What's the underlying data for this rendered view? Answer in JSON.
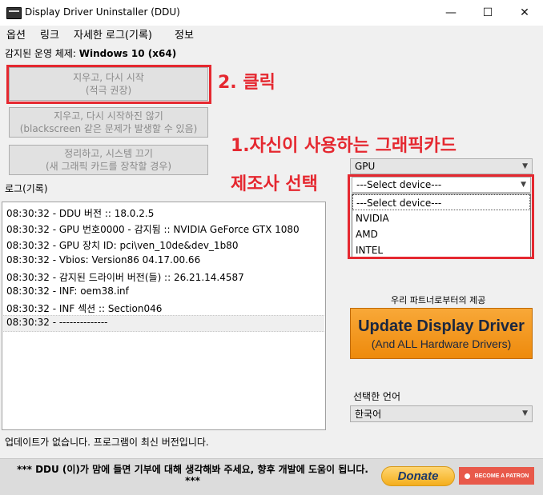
{
  "window": {
    "title": "Display Driver Uninstaller (DDU)",
    "minimize": "—",
    "maximize": "☐",
    "close": "✕"
  },
  "menu": [
    "옵션",
    "링크",
    "자세한 로그(기록)",
    "정보"
  ],
  "os": {
    "label": "감지된 운영 체제:",
    "value": "Windows 10 (x64)"
  },
  "buttons": {
    "clean_restart": {
      "line1": "지우고, 다시 시작",
      "line2": "(적극 권장)"
    },
    "clean_no_restart": {
      "line1": "지우고, 다시 시작하진 않기",
      "line2": "(blackscreen 같은 문제가 발생할 수 있음)"
    },
    "clean_shutdown": {
      "line1": "정리하고, 시스템 끄기",
      "line2": "(새 그래픽 카드를 장착할 경우)"
    }
  },
  "annotations": {
    "step2": "2. 클릭",
    "step1_line1": "1.자신이 사용하는 그래픽카드",
    "step1_line2": "제조사 선택"
  },
  "log": {
    "label": "로그(기록)",
    "lines": [
      "08:30:32 - DDU 버전 :: 18.0.2.5",
      "08:30:32 - GPU 번호0000 - 감지됨 :: NVIDIA GeForce GTX 1080",
      "08:30:32 - GPU 장치 ID: pci\\ven_10de&dev_1b80",
      "08:30:32 - Vbios: Version86 04.17.00.66",
      "08:30:32 - 감지된 드라이버 버전(들) :: 26.21.14.4587",
      "08:30:32 - INF: oem38.inf",
      "08:30:32 - INF 섹션 :: Section046",
      "08:30:32 - --------------"
    ]
  },
  "device_type": {
    "selected": "GPU"
  },
  "device_select": {
    "selected": "---Select device---",
    "options": [
      "---Select device---",
      "NVIDIA",
      "AMD",
      "INTEL"
    ]
  },
  "partner": {
    "label": "우리 파트너로부터의 제공",
    "banner_main": "Update Display Driver",
    "banner_sub": "(And ALL Hardware Drivers)"
  },
  "language": {
    "label": "선택한 언어",
    "selected": "한국어"
  },
  "status": "업데이트가 없습니다.  프로그램이 최신 버전입니다.",
  "footer": {
    "message_line1": "*** DDU (이)가 맘에 들면 기부에 대해 생각해봐 주세요, 향후 개발에 도움이 됩니다.",
    "message_line2": "***",
    "donate": "Donate",
    "patron": "BECOME A PATRON"
  }
}
